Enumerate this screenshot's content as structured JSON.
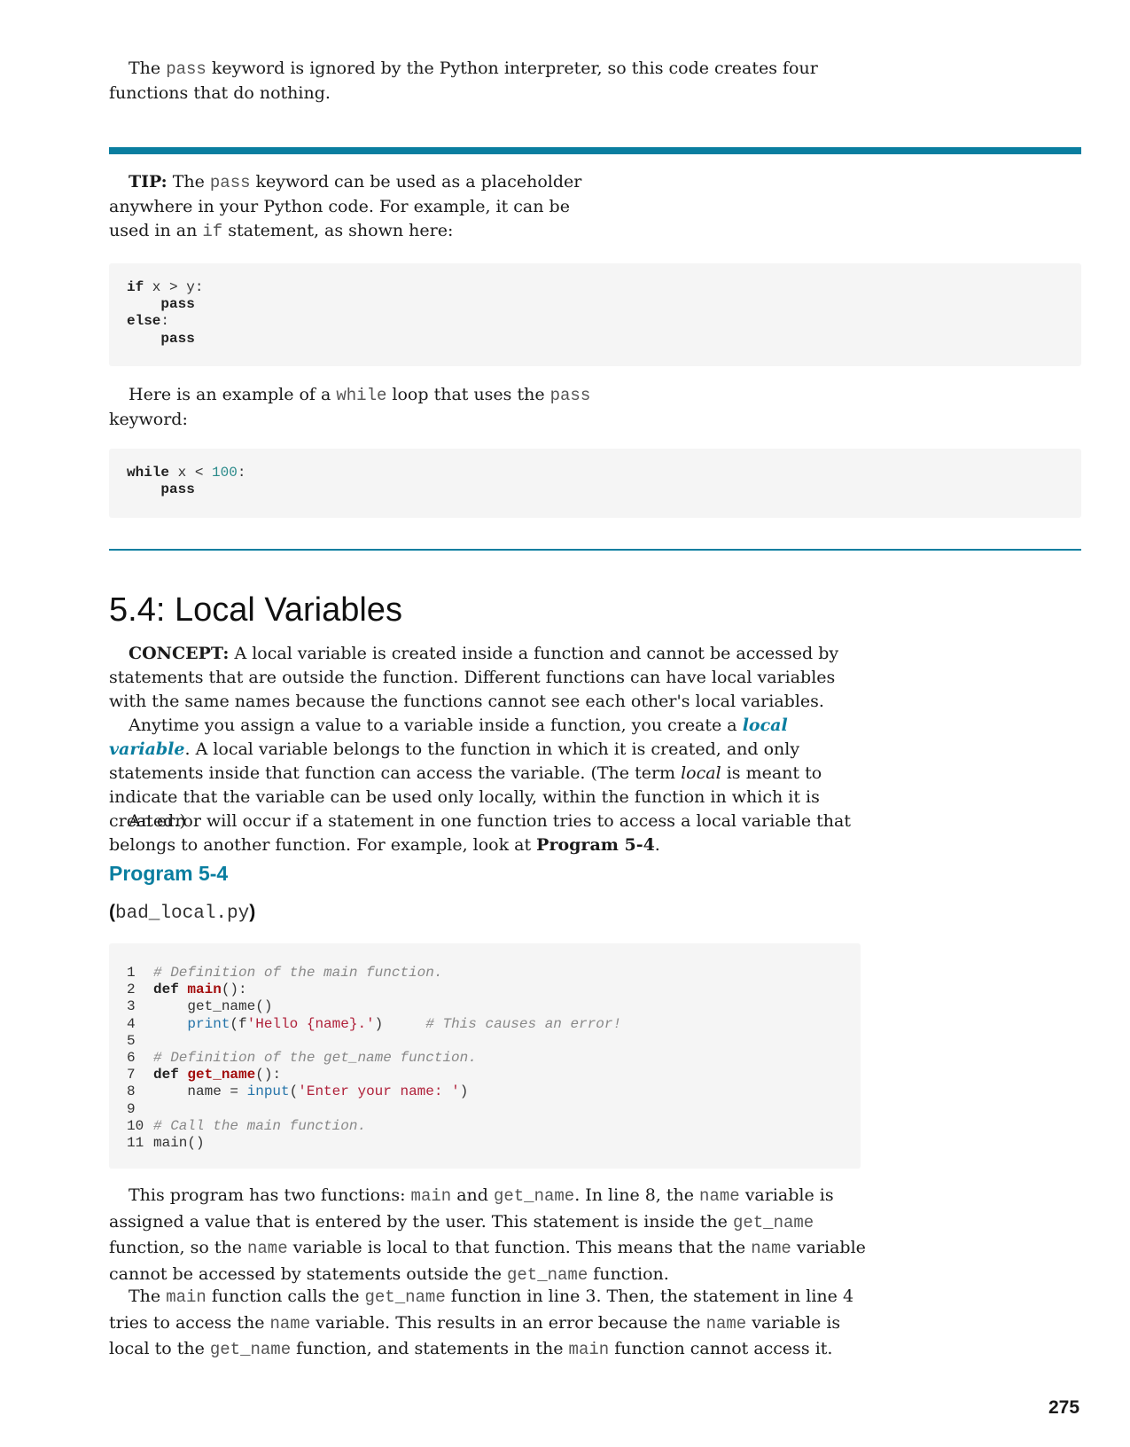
{
  "intro": {
    "t1": "The ",
    "c1": "pass",
    "t2": " keyword is ignored by the Python interpreter, so this code creates four functions that do nothing."
  },
  "tip": {
    "label": "TIP:",
    "t1": " The ",
    "c1": "pass",
    "t2": " keyword can be used as a placeholder anywhere in your Python code. For example, it can be used in an ",
    "c2": "if",
    "t3": " statement, as shown here:",
    "code1": [
      "if x > y:",
      "    pass",
      "else:",
      "    pass"
    ],
    "p2_t1": "Here is an example of a ",
    "p2_c1": "while",
    "p2_t2": " loop that uses the ",
    "p2_c2": "pass",
    "p2_t3": " keyword:",
    "code2": [
      "while x < 100:",
      "    pass"
    ]
  },
  "section": {
    "heading": "5.4: Local Variables",
    "concept_label": "CONCEPT:",
    "concept_text": " A local variable is created inside a function and cannot be accessed by statements that are outside the function. Different functions can have local variables with the same names because the functions cannot see each other's local variables.",
    "p1_t1": "Anytime you assign a value to a variable inside a function, you create a ",
    "p1_term": "local variable",
    "p1_t2": ". A local variable belongs to the function in which it is created, and only statements inside that function can access the variable. (The term ",
    "p1_em": "local",
    "p1_t3": " is meant to indicate that the variable can be used only locally, within the function in which it is created.)",
    "p2_t1": "An error will occur if a statement in one function tries to access a local variable that belongs to another function. For example, look at ",
    "p2_b": "Program 5-4",
    "p2_t2": "."
  },
  "program": {
    "title": "Program 5-4",
    "file_open": "(",
    "file_name": "bad_local.py",
    "file_close": ")",
    "lines": [
      {
        "n": "1",
        "code": "# Definition of the main function."
      },
      {
        "n": "2",
        "code": "def main():"
      },
      {
        "n": "3",
        "code": "    get_name()"
      },
      {
        "n": "4",
        "code": "    print(f'Hello {name}.')     # This causes an error!"
      },
      {
        "n": "5",
        "code": ""
      },
      {
        "n": "6",
        "code": "# Definition of the get_name function."
      },
      {
        "n": "7",
        "code": "def get_name():"
      },
      {
        "n": "8",
        "code": "    name = input('Enter your name: ')"
      },
      {
        "n": "9",
        "code": ""
      },
      {
        "n": "10",
        "code": "# Call the main function."
      },
      {
        "n": "11",
        "code": "main()"
      }
    ]
  },
  "after": {
    "p1": [
      "This program has two functions: ",
      "main",
      " and ",
      "get_name",
      ". In line 8, the ",
      "name",
      " variable is assigned a value that is entered by the user. This statement is inside the ",
      "get_name",
      " function, so the ",
      "name",
      " variable is local to that function. This means that the ",
      "name",
      " variable cannot be accessed by statements outside the ",
      "get_name",
      " function."
    ],
    "p2": [
      "The ",
      "main",
      " function calls the ",
      "get_name",
      " function in line 3. Then, the statement in line 4 tries to access the ",
      "name",
      " variable. This results in an error because the ",
      "name",
      " variable is local to the ",
      "get_name",
      " function, and statements in the ",
      "main",
      " function cannot access it."
    ]
  },
  "page_number": "275",
  "colors": {
    "accent": "#0a7ea0",
    "code_bg": "#f5f5f5"
  }
}
